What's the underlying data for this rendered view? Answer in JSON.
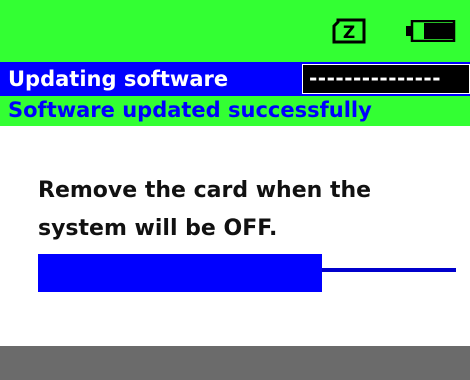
{
  "header": {
    "icons": [
      "sd-card-z-icon",
      "battery-icon"
    ]
  },
  "title_bar": {
    "title": "Updating software",
    "progress_text": "---------------"
  },
  "status": {
    "text": "Software updated successfully"
  },
  "message": {
    "line1": "Remove the card when the",
    "line2": "system will be OFF."
  },
  "progress": {
    "fraction": 0.68
  },
  "colors": {
    "green": "#33ff33",
    "blue": "#0000ff",
    "black": "#000000",
    "gray": "#6b6b6b"
  }
}
